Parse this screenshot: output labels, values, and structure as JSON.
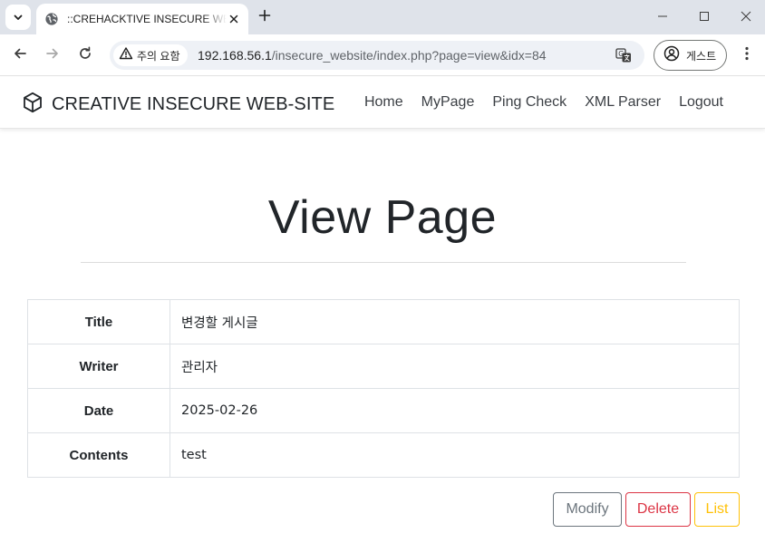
{
  "browser": {
    "tab_title": "::CREHACKTIVE INSECURE WEB-SITE::",
    "security_label": "주의 요함",
    "url_host": "192.168.56.1",
    "url_path": "/insecure_website/index.php?page=view&idx=84",
    "profile_label": "게스트"
  },
  "site": {
    "brand": "CREATIVE INSECURE WEB-SITE",
    "nav": [
      "Home",
      "MyPage",
      "Ping Check",
      "XML Parser",
      "Logout"
    ]
  },
  "page": {
    "title": "View Page",
    "rows": [
      {
        "label": "Title",
        "value": "변경할 게시글"
      },
      {
        "label": "Writer",
        "value": "관리자"
      },
      {
        "label": "Date",
        "value": "2025-02-26"
      },
      {
        "label": "Contents",
        "value": "test"
      }
    ],
    "buttons": {
      "modify": "Modify",
      "delete": "Delete",
      "list": "List"
    }
  },
  "colors": {
    "modify": "#6c757d",
    "delete": "#dc3545",
    "list": "#ffc107"
  }
}
